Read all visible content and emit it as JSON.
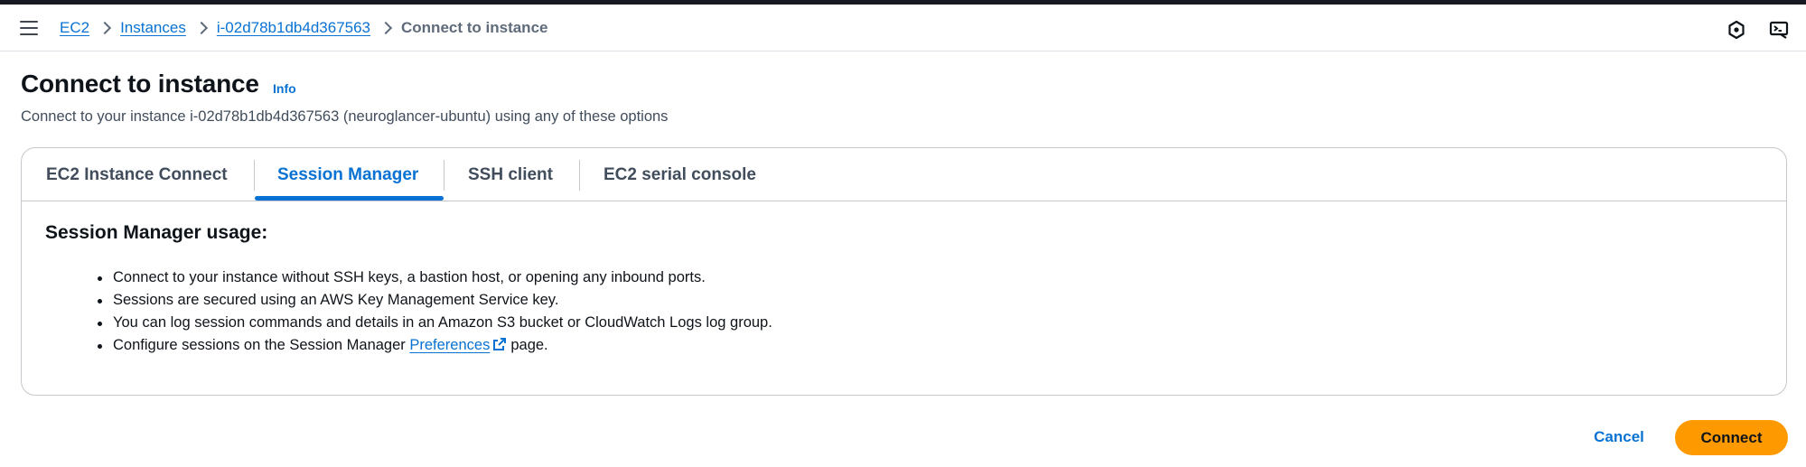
{
  "breadcrumb": {
    "items": [
      "EC2",
      "Instances",
      "i-02d78b1db4d367563"
    ],
    "current": "Connect to instance"
  },
  "header": {
    "title": "Connect to instance",
    "info_label": "Info",
    "description": "Connect to your instance i-02d78b1db4d367563 (neuroglancer-ubuntu) using any of these options"
  },
  "tabs": [
    {
      "label": "EC2 Instance Connect",
      "active": false
    },
    {
      "label": "Session Manager",
      "active": true
    },
    {
      "label": "SSH client",
      "active": false
    },
    {
      "label": "EC2 serial console",
      "active": false
    }
  ],
  "panel": {
    "heading": "Session Manager usage:",
    "bullets": [
      "Connect to your instance without SSH keys, a bastion host, or opening any inbound ports.",
      "Sessions are secured using an AWS Key Management Service key.",
      "You can log session commands and details in an Amazon S3 bucket or CloudWatch Logs log group."
    ],
    "last_bullet": {
      "prefix": "Configure sessions on the Session Manager",
      "link": "Preferences",
      "suffix": "page."
    }
  },
  "actions": {
    "cancel_label": "Cancel",
    "connect_label": "Connect"
  },
  "icons": {
    "menu": "hamburger-menu-icon",
    "chevron": "chevron-right-icon",
    "notifications": "hexagon-notifications-icon",
    "cloudshell": "cloudshell-icon",
    "external": "external-link-icon"
  },
  "colors": {
    "link": "#0972d3",
    "primary_button": "#ff9900",
    "top_bar": "#16191f"
  }
}
